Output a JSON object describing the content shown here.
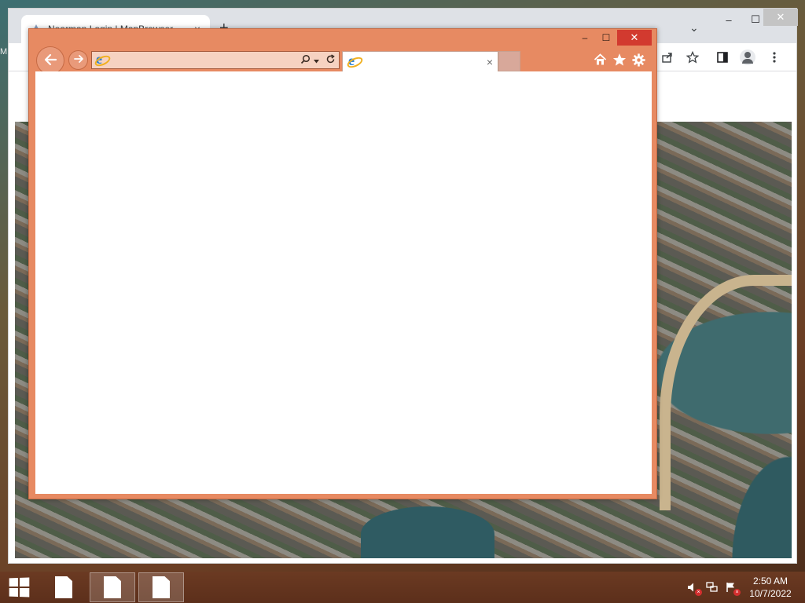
{
  "desktop": {
    "edge_text": "M"
  },
  "chrome": {
    "tab_title": "Nearman Login | MapBrowser ...",
    "tab_close": "×",
    "new_tab": "+",
    "tab_list": "⌄",
    "minimize": "–",
    "maximize": "☐",
    "close": "✕",
    "icons": [
      "share-icon",
      "star-icon",
      "side-panel-icon",
      "profile-icon",
      "more-menu-icon"
    ]
  },
  "ie": {
    "address_value": "",
    "tab_title": "",
    "tab_close": "×",
    "minimize": "–",
    "maximize": "☐",
    "close": "✕",
    "icons": [
      "back-arrow-icon",
      "forward-arrow-icon",
      "search-icon",
      "refresh-icon",
      "home-icon",
      "star-icon",
      "gear-icon"
    ],
    "accent_color": "#e78a62",
    "close_color": "#d23a2f"
  },
  "taskbar": {
    "time": "2:50 AM",
    "date": "10/7/2022",
    "color": "#5c2f1b"
  }
}
